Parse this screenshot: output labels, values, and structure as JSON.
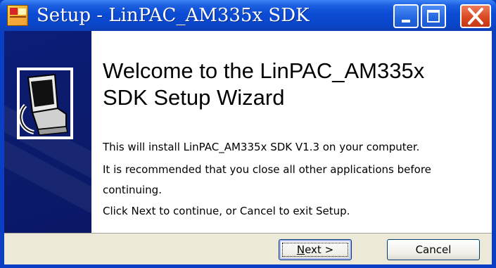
{
  "window": {
    "title": "Setup - LinPAC_AM335x SDK"
  },
  "titlebar_buttons": {
    "minimize_icon": "minimize-icon",
    "maximize_icon": "maximize-icon",
    "close_icon": "close-icon"
  },
  "wizard": {
    "heading_line1": "Welcome to the LinPAC_AM335x",
    "heading_line2": "SDK Setup Wizard",
    "line1": "This will install LinPAC_AM335x SDK V1.3 on your computer.",
    "line2": "It is recommended that you close all other applications before",
    "line3": "continuing.",
    "line4": "Click Next to continue, or Cancel to exit Setup."
  },
  "buttons": {
    "next_mnemonic": "N",
    "next_rest": "ext >",
    "cancel": "Cancel"
  },
  "colors": {
    "titlebar": "#0b4bd4",
    "sidebar": "#0a1e7a",
    "footer": "#ece9d8",
    "close_button": "#d8461f"
  }
}
